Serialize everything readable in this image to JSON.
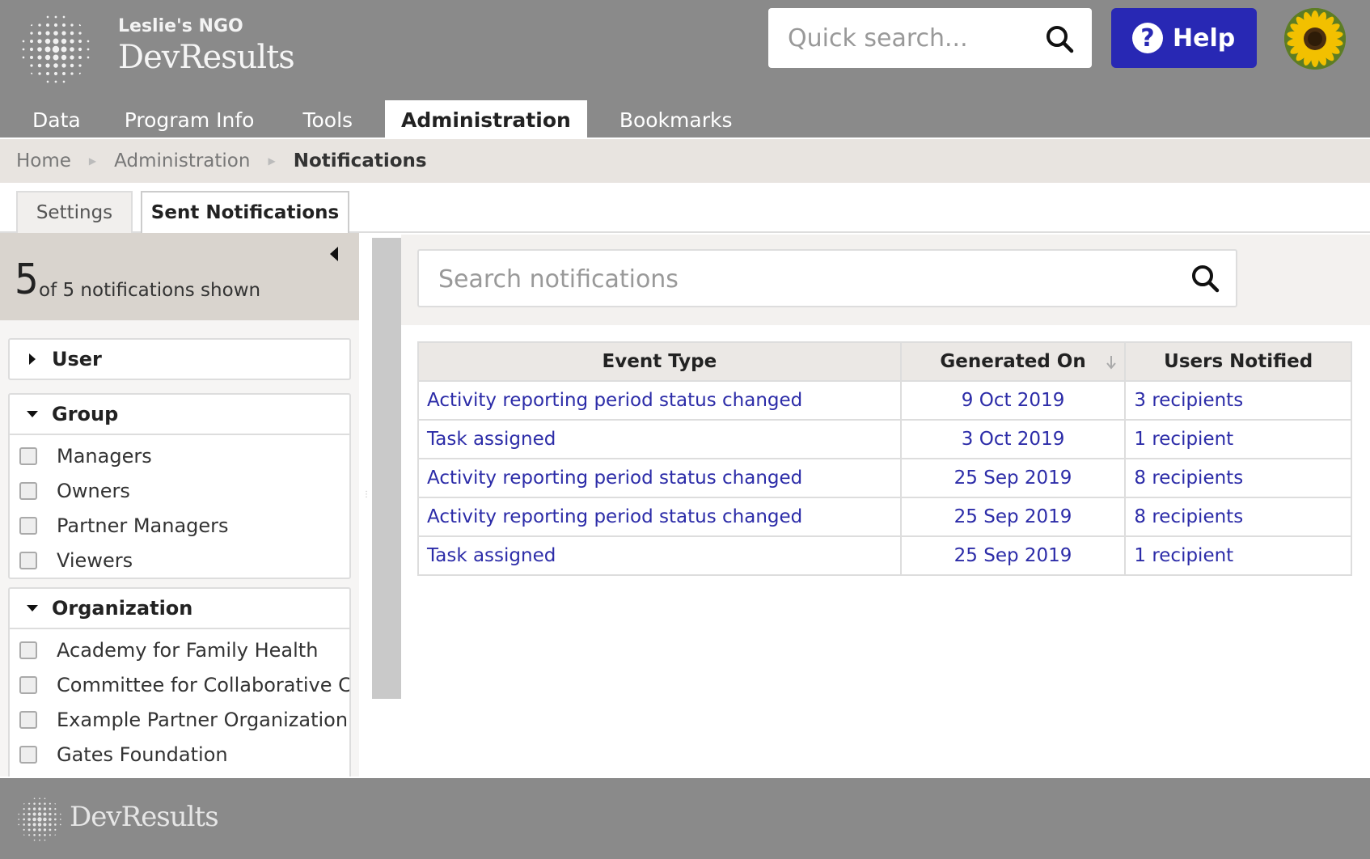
{
  "header": {
    "org_name": "Leslie's NGO",
    "brand": "DevResults",
    "quick_search_placeholder": "Quick search...",
    "help_label": "Help",
    "help_icon_glyph": "?"
  },
  "nav": {
    "items": [
      {
        "label": "Data"
      },
      {
        "label": "Program Info"
      },
      {
        "label": "Tools"
      },
      {
        "label": "Administration",
        "active": true
      },
      {
        "label": "Bookmarks"
      }
    ]
  },
  "breadcrumb": {
    "home": "Home",
    "admin": "Administration",
    "current": "Notifications"
  },
  "tabs": {
    "settings": "Settings",
    "sent": "Sent Notifications"
  },
  "sidebar": {
    "count": "5",
    "count_text": "of 5 notifications shown",
    "facets": {
      "user": {
        "title": "User",
        "expanded": false
      },
      "group": {
        "title": "Group",
        "expanded": true,
        "options": [
          "Managers",
          "Owners",
          "Partner Managers",
          "Viewers"
        ]
      },
      "organization": {
        "title": "Organization",
        "expanded": true,
        "options": [
          "Academy for Family Health",
          "Committee for Collaborative C...",
          "Example Partner Organization",
          "Gates Foundation"
        ]
      }
    }
  },
  "main": {
    "search_placeholder": "Search notifications",
    "columns": {
      "event_type": "Event Type",
      "generated_on": "Generated On",
      "users_notified": "Users Notified"
    },
    "rows": [
      {
        "event": "Activity reporting period status changed",
        "date": "9 Oct 2019",
        "users": "3 recipients"
      },
      {
        "event": "Task assigned",
        "date": "3 Oct 2019",
        "users": "1 recipient"
      },
      {
        "event": "Activity reporting period status changed",
        "date": "25 Sep 2019",
        "users": "8 recipients"
      },
      {
        "event": "Activity reporting period status changed",
        "date": "25 Sep 2019",
        "users": "8 recipients"
      },
      {
        "event": "Task assigned",
        "date": "25 Sep 2019",
        "users": "1 recipient"
      }
    ]
  },
  "footer": {
    "brand": "DevResults"
  },
  "colors": {
    "header_bg": "#8a8a8a",
    "help_button": "#2828b4",
    "link": "#2c2ca8",
    "breadcrumb_bg": "#e8e4e0",
    "summary_bg": "#d9d4ce"
  }
}
